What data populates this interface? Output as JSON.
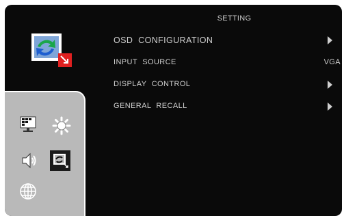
{
  "header": {
    "title": "SETTING"
  },
  "items": [
    {
      "label": "OSD CONFIGURATION",
      "value": "",
      "arrow": true
    },
    {
      "label": "INPUT  SOURCE",
      "value": "VGA",
      "arrow": false
    },
    {
      "label": "DISPLAY  CONTROL",
      "value": "",
      "arrow": true
    },
    {
      "label": "GENERAL RECALL",
      "value": "",
      "arrow": true
    }
  ],
  "menu_icons": [
    "picture-icon",
    "brightness-icon",
    "audio-icon",
    "setting-icon",
    "language-icon"
  ],
  "selected_icon": "setting-icon",
  "colors": {
    "background": "#0a0a0a",
    "panel": "#b9b9b9",
    "text": "#d0d0d0",
    "accent_red": "#e02020",
    "accent_green": "#1aa64a",
    "accent_blue": "#1e5fd0"
  }
}
